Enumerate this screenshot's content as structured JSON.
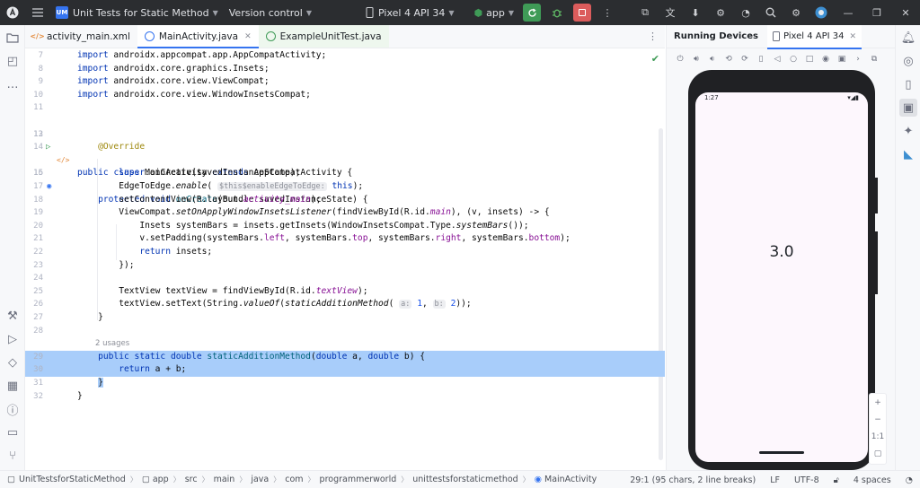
{
  "titlebar": {
    "project": "Unit Tests for Static Method",
    "project_badge": "UM",
    "vcs": "Version control",
    "device": "Pixel 4 API 34",
    "run_config": "app"
  },
  "tabs": [
    {
      "label": "activity_main.xml",
      "icon": "xml-file-icon"
    },
    {
      "label": "MainActivity.java",
      "icon": "java-class-icon",
      "active": true
    },
    {
      "label": "ExampleUnitTest.java",
      "icon": "java-test-class-icon"
    }
  ],
  "code": {
    "l7": {
      "n": "7",
      "imp": "import",
      "t": " androidx.appcompat.app.AppCompatActivity;"
    },
    "l8": {
      "n": "8",
      "imp": "import",
      "t": " androidx.core.graphics.Insets;"
    },
    "l9": {
      "n": "9",
      "imp": "import",
      "t": " androidx.core.view.ViewCompat;"
    },
    "l10": {
      "n": "10",
      "imp": "import",
      "t": " androidx.core.view.WindowInsetsCompat;"
    },
    "l11": {
      "n": "11"
    },
    "l12": {
      "n": "12",
      "k1": "public",
      "k2": "class",
      "name": "MainActivity",
      "k3": "extends",
      "rest": "AppCompatActivity {"
    },
    "l13": {
      "n": "13"
    },
    "l14": {
      "n": "14",
      "ann": "@Override"
    },
    "l15": {
      "n": "15",
      "k1": "protected",
      "k2": "void",
      "fn": "onCreate",
      "rest": "(Bundle savedInstanceState) {"
    },
    "l16": {
      "n": "16",
      "k1": "super",
      "rest": ".onCreate(savedInstanceState);"
    },
    "l17": {
      "n": "17",
      "pre": "EdgeToEdge.",
      "it": "enable",
      "open": "(",
      "hint": "$this$enableEdgeToEdge:",
      "k1": "this",
      "close": ");"
    },
    "l18": {
      "n": "18",
      "pre": "setContentView(R.layout.",
      "fld": "activity_main",
      "close": ");"
    },
    "l19": {
      "n": "19",
      "pre": "ViewCompat.",
      "it": "setOnApplyWindowInsetsListener",
      "mid": "(findViewById(R.id.",
      "fld": "main",
      "close": "), (v, insets) -> {"
    },
    "l20": {
      "n": "20",
      "pre": "Insets systemBars = insets.getInsets(WindowInsetsCompat.Type.",
      "it": "systemBars",
      "close": "());"
    },
    "l21": {
      "n": "21",
      "pre": "v.setPadding(systemBars.",
      "f1": "left",
      "s1": ", systemBars.",
      "f2": "top",
      "s2": ", systemBars.",
      "f3": "right",
      "s3": ", systemBars.",
      "f4": "bottom",
      "close": ");"
    },
    "l22": {
      "n": "22",
      "k1": "return",
      "rest": " insets;"
    },
    "l23": {
      "n": "23",
      "t": "});"
    },
    "l24": {
      "n": "24"
    },
    "l25": {
      "n": "25",
      "pre": "TextView textView = findViewById(R.id.",
      "fld": "textView",
      "close": ");"
    },
    "l26": {
      "n": "26",
      "pre": "textView.setText(String.",
      "it": "valueOf",
      "open": "(",
      "it2": "staticAdditionMethod",
      "open2": "(",
      "h1": "a:",
      "n1": "1",
      "comma": ",",
      "h2": "b:",
      "n2": "2",
      "close": "));"
    },
    "l27": {
      "n": "27",
      "t": "}"
    },
    "l28": {
      "n": "28"
    },
    "usages": "2 usages",
    "l29": {
      "n": "29",
      "k1": "public",
      "k2": "static",
      "k3": "double",
      "fn": "staticAdditionMethod",
      "open": "(",
      "k4": "double",
      "a": " a, ",
      "k5": "double",
      "b": " b) {"
    },
    "l30": {
      "n": "30",
      "k1": "return",
      "rest": " a + b;"
    },
    "l31": {
      "n": "31",
      "t": "}"
    },
    "l32": {
      "n": "32",
      "t": "}"
    }
  },
  "devices": {
    "title": "Running Devices",
    "tab": "Pixel 4 API 34",
    "status_time": "1:27",
    "result": "3.0",
    "zoom_ratio": "1:1"
  },
  "status": {
    "breadcrumb": [
      "UnitTestsforStaticMethod",
      "app",
      "src",
      "main",
      "java",
      "com",
      "programmerworld",
      "unittestsforstaticmethod",
      "MainActivity"
    ],
    "position": "29:1 (95 chars, 2 line breaks)",
    "line_sep": "LF",
    "encoding": "UTF-8",
    "indent": "4 spaces"
  },
  "colors": {
    "accent": "#3574f0",
    "selection": "#a8cdfa",
    "run_green": "#3f9b57",
    "stop_red": "#db5c5c"
  }
}
